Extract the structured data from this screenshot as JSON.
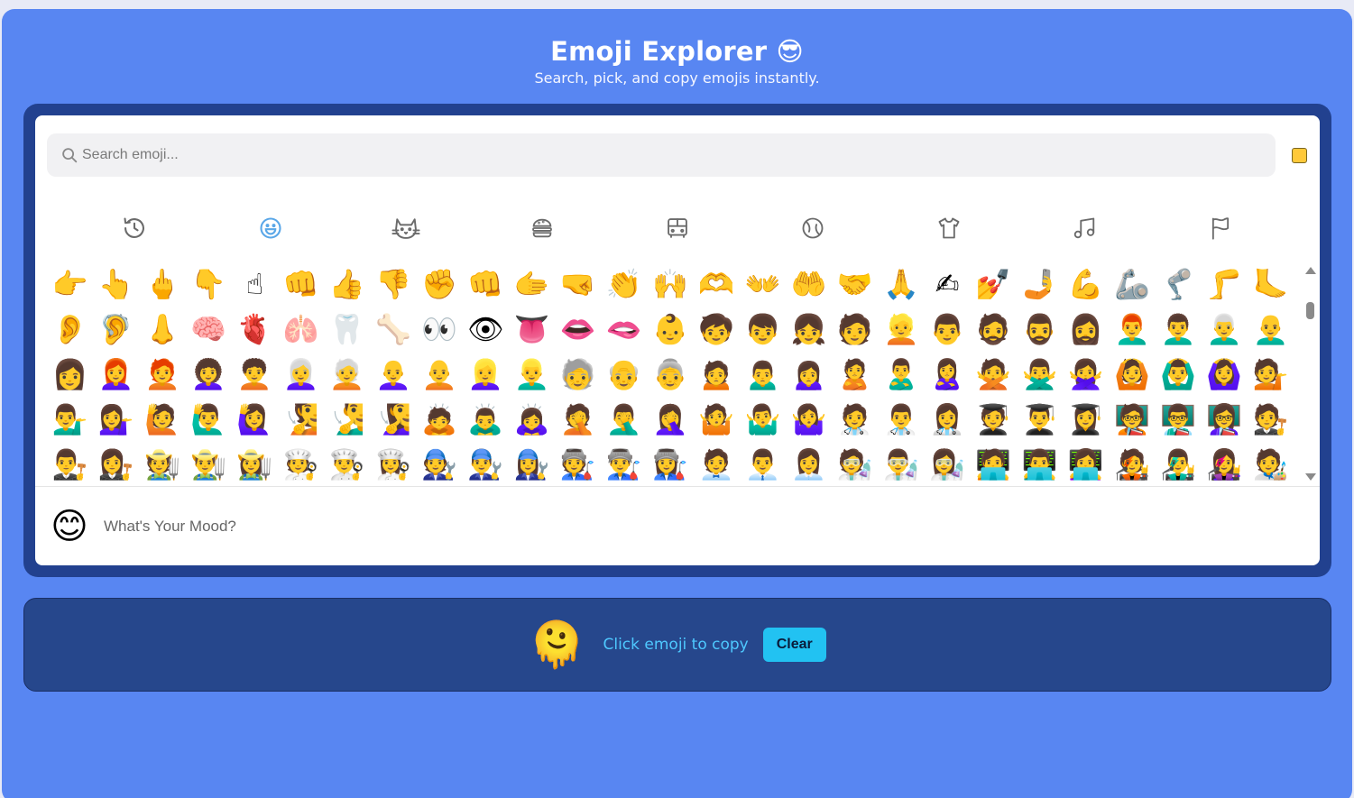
{
  "header": {
    "title": "Emoji Explorer 😎",
    "subtitle": "Search, pick, and copy emojis instantly."
  },
  "search": {
    "placeholder": "Search emoji..."
  },
  "skin_tone": {
    "color": "#ffc93a"
  },
  "categories": [
    {
      "name": "recent",
      "icon": "clock-history-icon",
      "active": false
    },
    {
      "name": "smileys",
      "icon": "smiley-face-icon",
      "active": true
    },
    {
      "name": "animals",
      "icon": "cat-icon",
      "active": false
    },
    {
      "name": "food",
      "icon": "burger-icon",
      "active": false
    },
    {
      "name": "travel",
      "icon": "bus-icon",
      "active": false
    },
    {
      "name": "activities",
      "icon": "ball-icon",
      "active": false
    },
    {
      "name": "objects",
      "icon": "shirt-icon",
      "active": false
    },
    {
      "name": "symbols",
      "icon": "music-note-icon",
      "active": false
    },
    {
      "name": "flags",
      "icon": "flag-icon",
      "active": false
    }
  ],
  "emojis": [
    "👉",
    "👆",
    "🖕",
    "👇",
    "☝",
    "👊",
    "👍",
    "👎",
    "✊",
    "👊",
    "🫱",
    "🤜",
    "👏",
    "🙌",
    "🫶",
    "👐",
    "🤲",
    "🤝",
    "🙏",
    "✍",
    "💅",
    "🤳",
    "💪",
    "🦾",
    "🦿",
    "🦵",
    "🦶",
    "👂",
    "🦻",
    "👃",
    "🧠",
    "🫀",
    "🫁",
    "🦷",
    "🦴",
    "👀",
    "👁",
    "👅",
    "👄",
    "🫦",
    "👶",
    "🧒",
    "👦",
    "👧",
    "🧑",
    "👱",
    "👨",
    "🧔",
    "🧔‍♂️",
    "🧔‍♀️",
    "👨‍🦰",
    "👨‍🦱",
    "👨‍🦳",
    "👨‍🦲",
    "👩",
    "👩‍🦰",
    "🧑‍🦰",
    "👩‍🦱",
    "🧑‍🦱",
    "👩‍🦳",
    "🧑‍🦳",
    "👩‍🦲",
    "🧑‍🦲",
    "👱‍♀️",
    "👱‍♂️",
    "🧓",
    "👴",
    "👵",
    "🙍",
    "🙍‍♂️",
    "🙍‍♀️",
    "🙎",
    "🙎‍♂️",
    "🙎‍♀️",
    "🙅",
    "🙅‍♂️",
    "🙅‍♀️",
    "🙆",
    "🙆‍♂️",
    "🙆‍♀️",
    "💁",
    "💁‍♂️",
    "💁‍♀️",
    "🙋",
    "🙋‍♂️",
    "🙋‍♀️",
    "🧏",
    "🧏‍♂️",
    "🧏‍♀️",
    "🙇",
    "🙇‍♂️",
    "🙇‍♀️",
    "🤦",
    "🤦‍♂️",
    "🤦‍♀️",
    "🤷",
    "🤷‍♂️",
    "🤷‍♀️",
    "🧑‍⚕️",
    "👨‍⚕️",
    "👩‍⚕️",
    "🧑‍🎓",
    "👨‍🎓",
    "👩‍🎓",
    "🧑‍🏫",
    "👨‍🏫",
    "👩‍🏫",
    "🧑‍⚖️",
    "👨‍⚖️",
    "👩‍⚖️",
    "🧑‍🌾",
    "👨‍🌾",
    "👩‍🌾",
    "🧑‍🍳",
    "👨‍🍳",
    "👩‍🍳",
    "🧑‍🔧",
    "👨‍🔧",
    "👩‍🔧",
    "🧑‍🏭",
    "👨‍🏭",
    "👩‍🏭",
    "🧑‍💼",
    "👨‍💼",
    "👩‍💼",
    "🧑‍🔬",
    "👨‍🔬",
    "👩‍🔬",
    "🧑‍💻",
    "👨‍💻",
    "👩‍💻",
    "🧑‍🎤",
    "👨‍🎤",
    "👩‍🎤",
    "🧑‍🎨"
  ],
  "preview": {
    "emoji": "😊",
    "text": "What's Your Mood?"
  },
  "copy_bar": {
    "emoji": "🫠",
    "text": "Click emoji to copy",
    "clear_label": "Clear"
  }
}
